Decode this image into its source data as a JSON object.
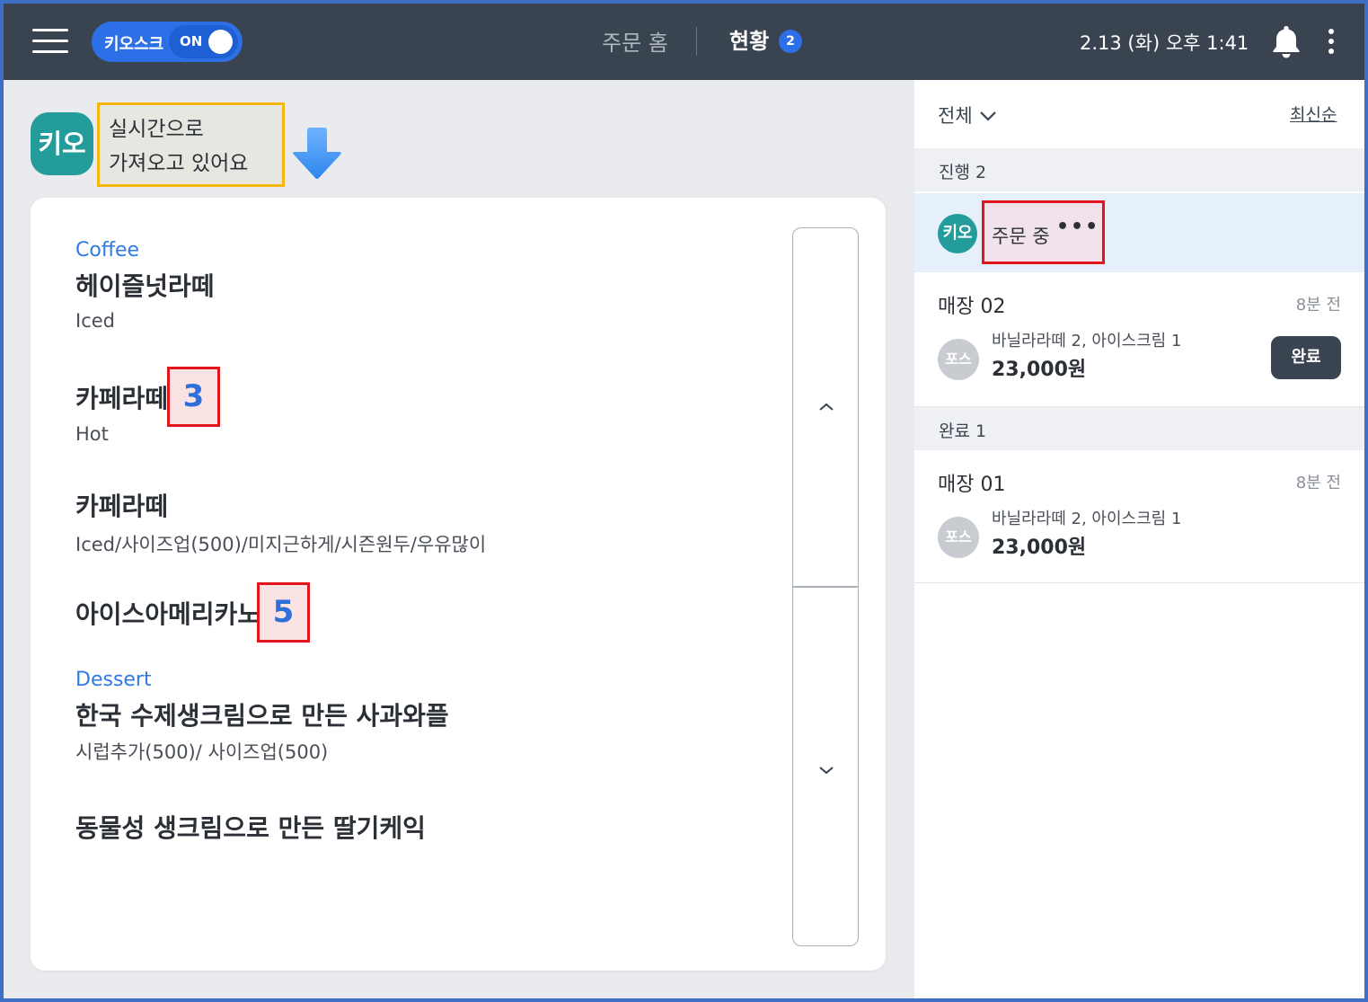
{
  "topbar": {
    "kiosk_label": "키오스크",
    "kiosk_state": "ON",
    "nav_home": "주문 홈",
    "nav_status": "현황",
    "status_badge": "2",
    "datetime": "2.13 (화) 오후 1:41"
  },
  "banner": {
    "avatar": "키오",
    "line1": "실시간으로",
    "line2": "가져오고 있어요"
  },
  "order": {
    "items": [
      {
        "category": "Coffee",
        "name": "헤이즐넛라떼",
        "option": "Iced"
      },
      {
        "name": "카페라떼",
        "qty": "3",
        "option": "Hot"
      },
      {
        "name": "카페라떼",
        "option": "Iced/사이즈업(500)/미지근하게/시즌원두/우유많이"
      },
      {
        "name": "아이스아메리카노",
        "qty": "5"
      },
      {
        "category": "Dessert",
        "name": "한국 수제생크림으로 만든 사과와플",
        "option": "시럽추가(500)/ 사이즈업(500)"
      },
      {
        "name": "동물성 생크림으로 만든 딸기케익"
      }
    ]
  },
  "panel": {
    "filter_label": "전체",
    "sort_label": "최신순",
    "in_progress_label": "진행 2",
    "active_avatar": "키오",
    "active_status": "주문 중",
    "active_dots": "•••",
    "completed_label": "완료 1",
    "orders": [
      {
        "store": "매장 02",
        "ago": "8분 전",
        "source": "포스",
        "items": "바닐라라떼 2, 아이스크림 1",
        "price": "23,000원",
        "action": "완료"
      },
      {
        "store": "매장 01",
        "ago": "8분 전",
        "source": "포스",
        "items": "바닐라라떼 2, 아이스크림 1",
        "price": "23,000원"
      }
    ]
  },
  "colors": {
    "topbar_bg": "#3a4450",
    "accent_blue": "#2c6fe6",
    "kiosk_teal": "#239c9b",
    "highlight_red": "#e2141c",
    "highlight_yellow": "#f5b70f"
  },
  "icons": {
    "menu": "hamburger-icon",
    "notifications": "bell-icon",
    "more": "more-vertical-icon",
    "loading": "down-arrow-icon",
    "scroll_up": "chevron-up-icon",
    "scroll_down": "chevron-down-icon"
  }
}
